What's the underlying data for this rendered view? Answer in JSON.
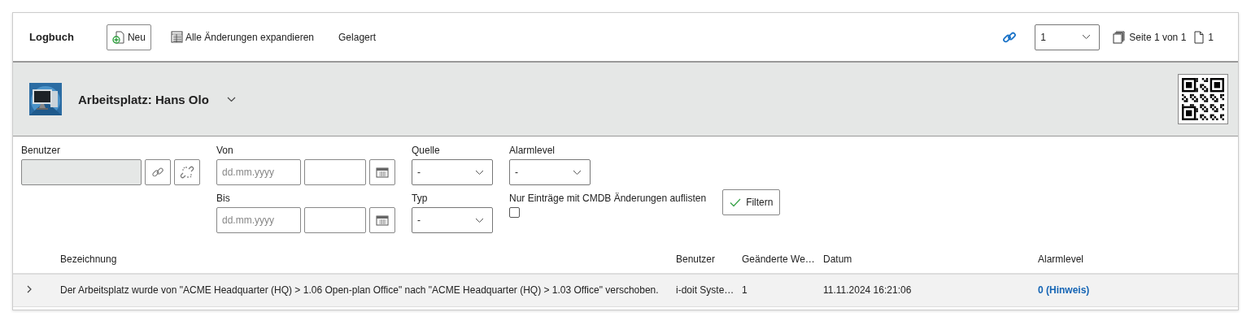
{
  "toolbar": {
    "title": "Logbuch",
    "buttons": [
      {
        "kind": "new",
        "label": "Neu"
      },
      {
        "kind": "expand",
        "label": "Alle Änderungen expandieren"
      },
      {
        "kind": "plain",
        "label": "Gelagert"
      }
    ],
    "page_select": {
      "value": "1"
    },
    "pages": "Seite 1 von 1",
    "count": "1"
  },
  "object": {
    "title": "Arbeitsplatz: Hans Olo"
  },
  "filters": {
    "user": {
      "label": "Benutzer"
    },
    "from": {
      "label": "Von",
      "placeholder": "dd.mm.yyyy"
    },
    "to": {
      "label": "Bis",
      "placeholder": "dd.mm.yyyy"
    },
    "source": {
      "label": "Quelle",
      "value": "-"
    },
    "type": {
      "label": "Typ",
      "value": "-"
    },
    "alarm": {
      "label": "Alarmlevel",
      "value": "-"
    },
    "cmdb_only": {
      "label": "Nur Einträge mit CMDB Änderungen auflisten",
      "checked": false
    },
    "button": "Filtern"
  },
  "table": {
    "columns": [
      "Bezeichnung",
      "Benutzer",
      "Geänderte We…",
      "Datum",
      "Alarmlevel"
    ],
    "rows": [
      {
        "expanded": false,
        "cells": [
          "Der Arbeitsplatz wurde von \"ACME Headquarter (HQ) > 1.06 Open-plan Office\" nach \"ACME Headquarter (HQ) > 1.03 Office\" verschoben.",
          "i-doit Syste…",
          "1",
          "11.11.2024 16:21:06",
          "0 (Hinweis)"
        ]
      }
    ]
  }
}
